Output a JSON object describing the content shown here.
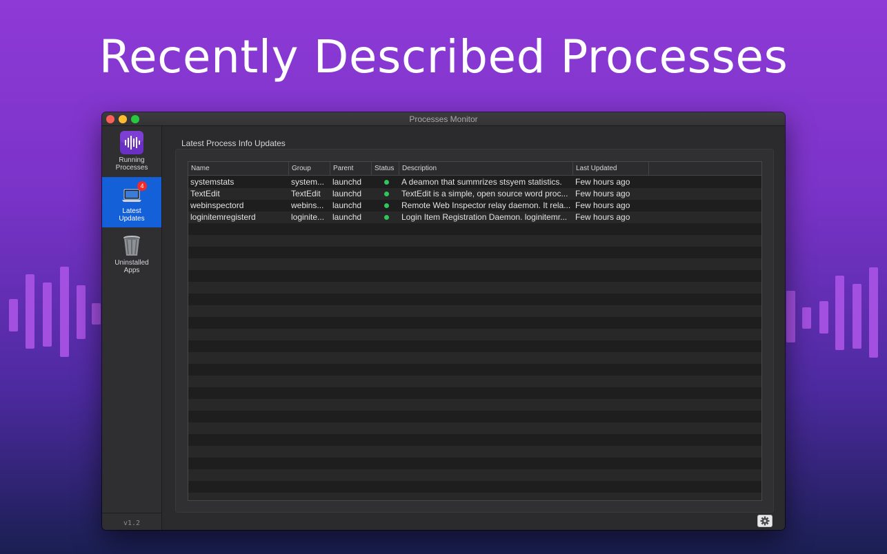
{
  "headline": "Recently Described Processes",
  "window": {
    "title": "Processes Monitor"
  },
  "sidebar": {
    "items": [
      {
        "label_line1": "Running",
        "label_line2": "Processes",
        "icon": "waveform-icon",
        "active": false
      },
      {
        "label_line1": "Latest",
        "label_line2": "Updates",
        "icon": "laptop-icon",
        "active": true,
        "badge": "4"
      },
      {
        "label_line1": "Uninstalled",
        "label_line2": "Apps",
        "icon": "trash-icon",
        "active": false
      }
    ],
    "version": "v1.2"
  },
  "main": {
    "group_title": "Latest Process Info Updates",
    "table": {
      "columns": [
        "Name",
        "Group",
        "Parent",
        "Status",
        "Description",
        "Last Updated"
      ],
      "rows": [
        {
          "name": "systemstats",
          "group": "system...",
          "parent": "launchd",
          "status": "running",
          "description": "A deamon that summrizes stsyem statistics.",
          "last_updated": "Few hours ago"
        },
        {
          "name": "TextEdit",
          "group": "TextEdit",
          "parent": "launchd",
          "status": "running",
          "description": "TextEdit is a simple, open source word proc...",
          "last_updated": "Few hours ago"
        },
        {
          "name": "webinspectord",
          "group": "webins...",
          "parent": "launchd",
          "status": "running",
          "description": "Remote Web Inspector relay daemon. It rela...",
          "last_updated": "Few hours ago"
        },
        {
          "name": "loginitemregisterd",
          "group": "loginite...",
          "parent": "launchd",
          "status": "running",
          "description": "Login Item Registration Daemon. loginitemr...",
          "last_updated": "Few hours ago"
        }
      ]
    },
    "settings_icon": "gear-icon"
  },
  "colors": {
    "accent": "#1460d8",
    "status_running": "#2fc65a",
    "badge": "#f02a2a",
    "waveform": "#a34fe0"
  }
}
